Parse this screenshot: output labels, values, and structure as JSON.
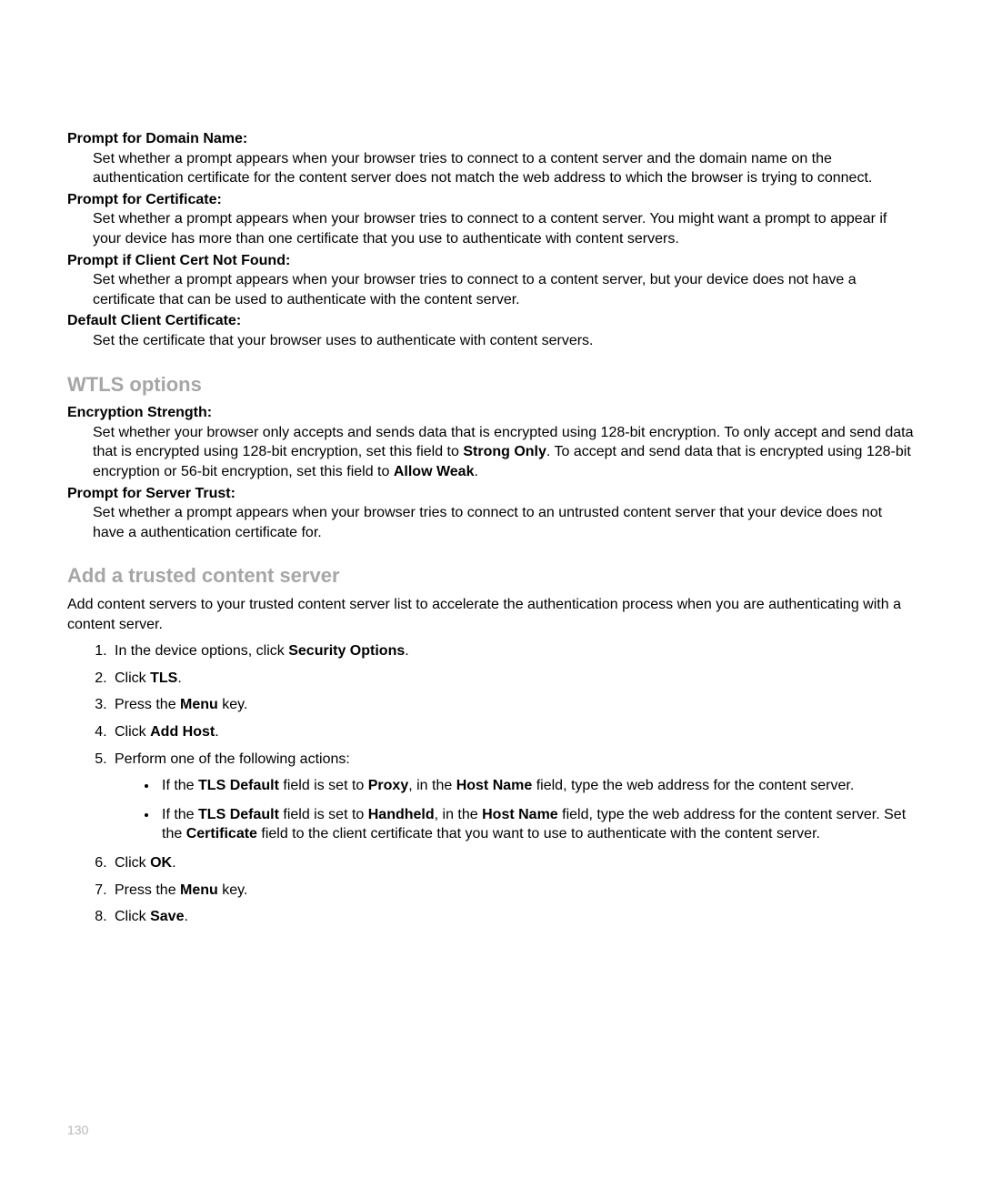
{
  "defs1": [
    {
      "term": "Prompt for Domain Name:",
      "body": "Set whether a prompt appears when your browser tries to connect to a content server and the domain name on the authentication certificate for the content server does not match the web address to which the browser is trying to connect."
    },
    {
      "term": "Prompt for Certificate:",
      "body": "Set whether a prompt appears when your browser tries to connect to a content server. You might want a prompt to appear if your device has more than one certificate that you use to authenticate with content servers."
    },
    {
      "term": "Prompt if Client Cert Not Found:",
      "body": "Set whether a prompt appears when your browser tries to connect to a content server, but your device does not have a certificate that can be used to authenticate with the content server."
    },
    {
      "term": "Default Client Certificate:",
      "body": "Set the certificate that your browser uses to authenticate with content servers."
    }
  ],
  "wtls": {
    "heading": "WTLS options",
    "encstrength_term": "Encryption Strength:",
    "encstrength_pre": "Set whether your browser only accepts and sends data that is encrypted using 128-bit encryption. To only accept and send data that is encrypted using 128-bit encryption, set this field to ",
    "encstrength_bold1": "Strong Only",
    "encstrength_mid": ". To accept and send data that is encrypted using 128-bit encryption or 56-bit encryption, set this field to ",
    "encstrength_bold2": "Allow Weak",
    "encstrength_end": ".",
    "servertrust_term": "Prompt for Server Trust:",
    "servertrust_body": "Set whether a prompt appears when your browser tries to connect to an untrusted content server that your device does not have a authentication certificate for."
  },
  "trusted": {
    "heading": "Add a trusted content server",
    "intro": "Add content servers to your trusted content server list to accelerate the authentication process when you are authenticating with a content server.",
    "step1_pre": "In the device options, click ",
    "step1_bold": "Security Options",
    "step1_end": ".",
    "step2_pre": "Click ",
    "step2_bold": "TLS",
    "step2_end": ".",
    "step3_pre": "Press the ",
    "step3_bold": "Menu",
    "step3_end": " key.",
    "step4_pre": "Click ",
    "step4_bold": "Add Host",
    "step4_end": ".",
    "step5": "Perform one of the following actions:",
    "bullet1_a": "If the ",
    "bullet1_b": "TLS Default",
    "bullet1_c": " field is set to ",
    "bullet1_d": "Proxy",
    "bullet1_e": ", in the ",
    "bullet1_f": "Host Name",
    "bullet1_g": " field, type the web address for the content server.",
    "bullet2_a": "If the ",
    "bullet2_b": "TLS Default",
    "bullet2_c": " field is set to ",
    "bullet2_d": "Handheld",
    "bullet2_e": ", in the ",
    "bullet2_f": "Host Name",
    "bullet2_g": " field, type the web address for the content server. Set the ",
    "bullet2_h": "Certificate",
    "bullet2_i": " field to the client certificate that you want to use to authenticate with the content server.",
    "step6_pre": "Click ",
    "step6_bold": "OK",
    "step6_end": ".",
    "step7_pre": "Press the ",
    "step7_bold": "Menu",
    "step7_end": " key.",
    "step8_pre": "Click ",
    "step8_bold": "Save",
    "step8_end": "."
  },
  "page_number": "130"
}
